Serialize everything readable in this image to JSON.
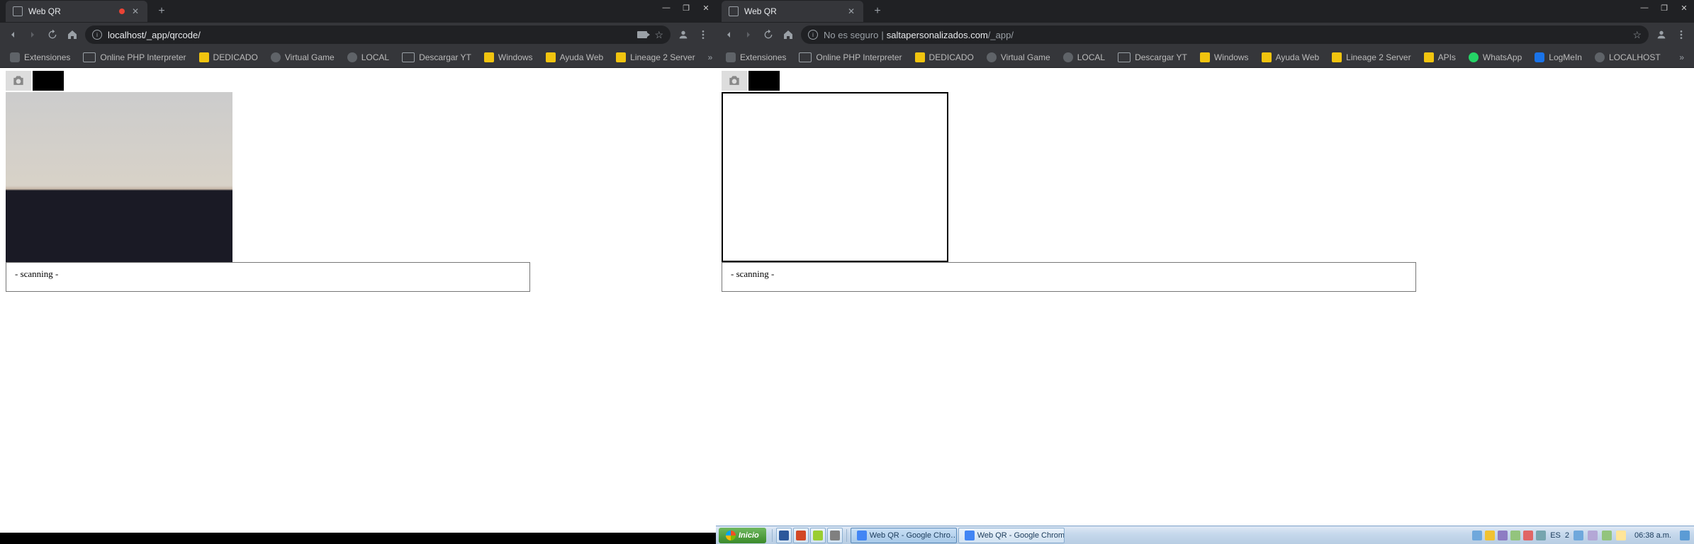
{
  "left_window": {
    "tab": {
      "title": "Web QR",
      "recording": true
    },
    "address": {
      "url": "localhost/_app/qrcode/"
    },
    "bookmarks": [
      {
        "label": "Extensiones",
        "icon": "ext"
      },
      {
        "label": "Online PHP Interpreter",
        "icon": "page"
      },
      {
        "label": "DEDICADO",
        "icon": "folder"
      },
      {
        "label": "Virtual Game",
        "icon": "gear"
      },
      {
        "label": "LOCAL",
        "icon": "gear"
      },
      {
        "label": "Descargar YT",
        "icon": "page"
      },
      {
        "label": "Windows",
        "icon": "folder"
      },
      {
        "label": "Ayuda Web",
        "icon": "folder"
      },
      {
        "label": "Lineage 2 Server",
        "icon": "folder"
      }
    ],
    "status": "- scanning -"
  },
  "right_window": {
    "tab": {
      "title": "Web QR",
      "recording": false
    },
    "address": {
      "warn": "No es seguro",
      "host": "saltapersonalizados.com",
      "path": "/_app/"
    },
    "bookmarks": [
      {
        "label": "Extensiones",
        "icon": "ext"
      },
      {
        "label": "Online PHP Interpreter",
        "icon": "page"
      },
      {
        "label": "DEDICADO",
        "icon": "folder"
      },
      {
        "label": "Virtual Game",
        "icon": "gear"
      },
      {
        "label": "LOCAL",
        "icon": "gear"
      },
      {
        "label": "Descargar YT",
        "icon": "page"
      },
      {
        "label": "Windows",
        "icon": "folder"
      },
      {
        "label": "Ayuda Web",
        "icon": "folder"
      },
      {
        "label": "Lineage 2 Server",
        "icon": "folder"
      },
      {
        "label": "APIs",
        "icon": "folder"
      },
      {
        "label": "WhatsApp",
        "icon": "green"
      },
      {
        "label": "LogMeIn",
        "icon": "dark"
      },
      {
        "label": "LOCALHOST",
        "icon": "gear"
      }
    ],
    "status": "- scanning -"
  },
  "taskbar": {
    "start": "Inicio",
    "quick": [
      {
        "color": "#2b579a"
      },
      {
        "color": "#d24726"
      },
      {
        "color": "#9acd32"
      },
      {
        "color": "#808080"
      }
    ],
    "apps": [
      {
        "label": "Web QR - Google Chro…",
        "color": "#4285f4",
        "active": true
      },
      {
        "label": "Web QR - Google Chrome",
        "color": "#4285f4",
        "active": false
      }
    ],
    "tray_icons": [
      {
        "color": "#6fa8dc"
      },
      {
        "color": "#f1c232"
      },
      {
        "color": "#8e7cc3"
      },
      {
        "color": "#93c47d"
      },
      {
        "color": "#e06666"
      },
      {
        "color": "#76a5af"
      }
    ],
    "lang": "ES",
    "tray_num": "2",
    "clock": "06:38 a.m."
  }
}
